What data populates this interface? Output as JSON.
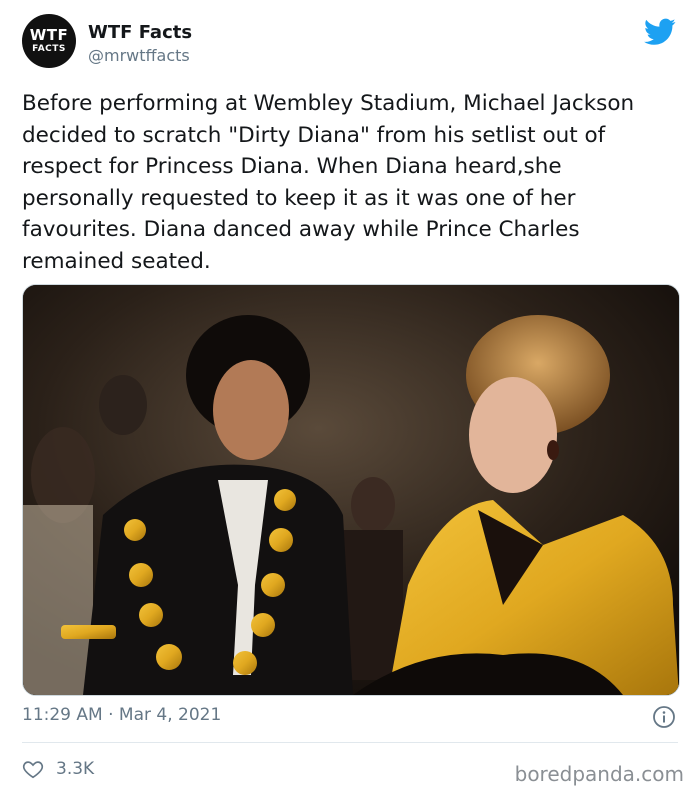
{
  "account": {
    "avatar_line1": "WTF",
    "avatar_line2": "FACTS",
    "name": "WTF Facts",
    "handle": "@mrwtffacts"
  },
  "tweet": {
    "text": "Before performing at Wembley Stadium, Michael Jackson decided to scratch \"Dirty Diana\" from his setlist out of respect for Princess Diana. When Diana heard,she personally requested to keep it as it was one of her favourites. Diana danced away while Prince Charles remained seated.",
    "timestamp": "11:29 AM · Mar 4, 2021",
    "likes": "3.3K"
  },
  "icons": {
    "brand": "twitter-bird-icon",
    "info": "info-icon",
    "like": "heart-icon"
  },
  "colors": {
    "twitter_blue": "#1DA1F2",
    "meta_gray": "#657786"
  },
  "watermark": "boredpanda.com"
}
